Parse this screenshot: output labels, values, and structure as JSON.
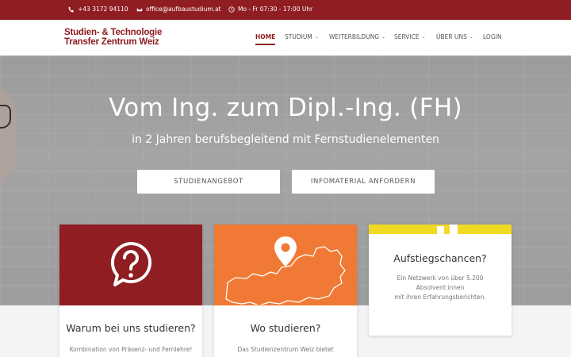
{
  "topbar": {
    "phone": "+43 3172 94110",
    "email": "office@aufbaustudium.at",
    "hours": "Mo - Fr 07:30 - 17:00 Uhr"
  },
  "logo": {
    "line1": "Studien- & Technologie",
    "line2": "Transfer Zentrum Weiz"
  },
  "nav": [
    {
      "label": "Home",
      "active": true
    },
    {
      "label": "Studium",
      "dropdown": true
    },
    {
      "label": "Weiterbildung",
      "dropdown": true
    },
    {
      "label": "Service",
      "dropdown": true
    },
    {
      "label": "Über uns",
      "dropdown": true
    },
    {
      "label": "Login"
    }
  ],
  "hero": {
    "title": "Vom Ing. zum Dipl.-Ing. (FH)",
    "subtitle": "in 2 Jahren berufsbegleitend mit Fernstudienelementen",
    "button1": "Studienangebot",
    "button2": "Infomaterial anfordern"
  },
  "cards": [
    {
      "title": "Warum bei uns studieren?",
      "text": "Kombination von Präsenz- und Fernlehre!",
      "color": "#8f1d22",
      "icon": "question-bubble-icon"
    },
    {
      "title": "Wo studieren?",
      "text": "Das Studienzentrum Weiz bietet",
      "color": "#f07a35",
      "icon": "austria-map-pin-icon"
    },
    {
      "title": "Aufstiegschancen?",
      "text_lines": [
        "Ein Netzwerk von über 5.200",
        "Absolvent:innen",
        "mit ihren Erfahrungsberichten."
      ],
      "color": "#f0da23"
    }
  ]
}
